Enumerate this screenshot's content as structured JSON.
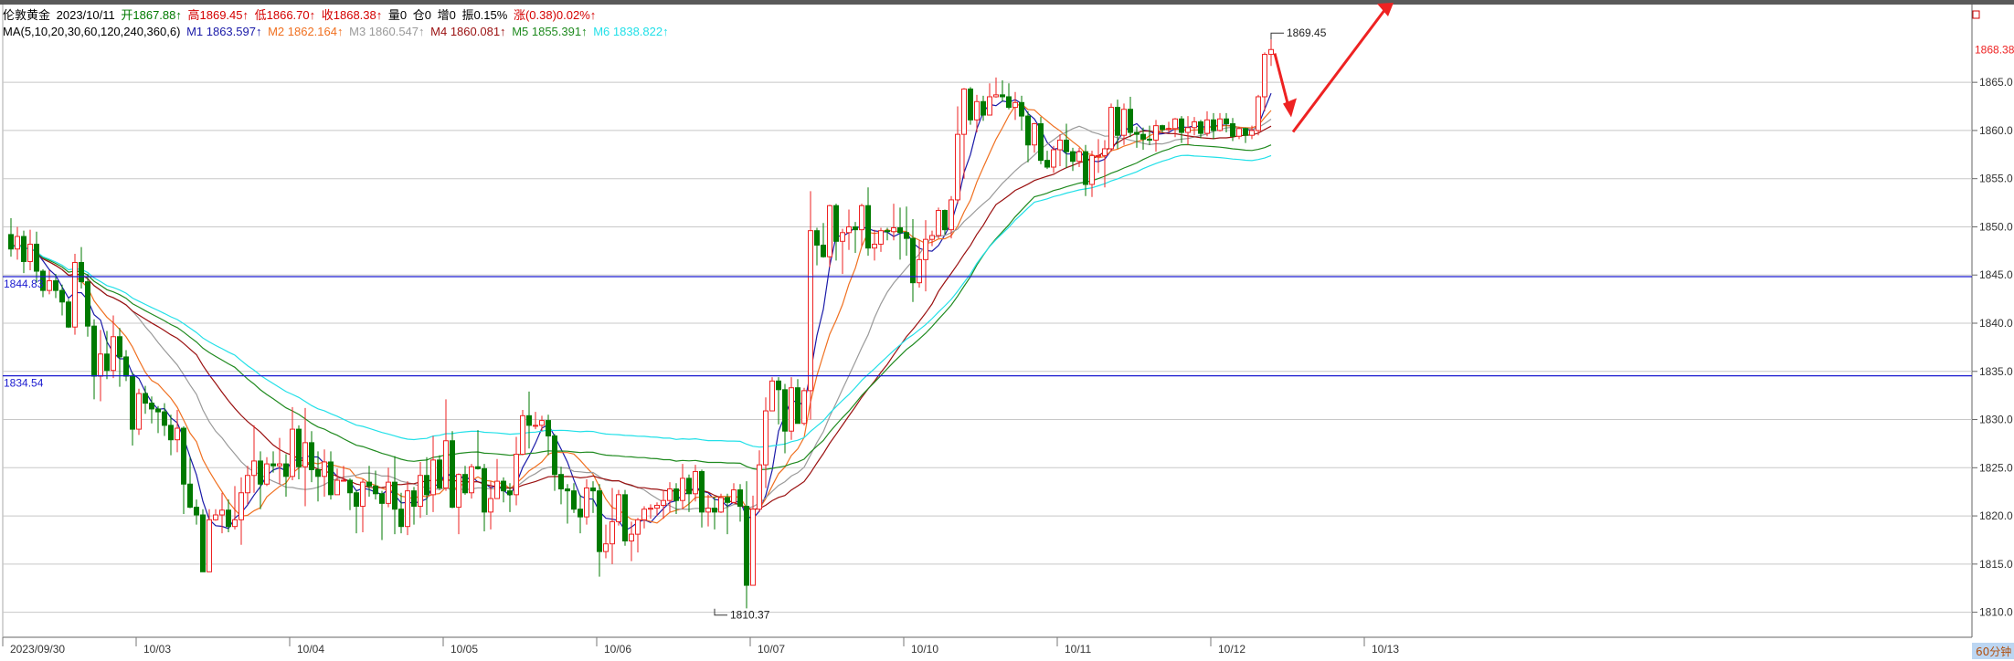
{
  "header": {
    "symbol": "伦敦黄金",
    "date": "2023/10/11",
    "open": "开1867.88↑",
    "high": "高1869.45↑",
    "low": "低1866.70↑",
    "close": "收1868.38↑",
    "volume": "量0",
    "position": "仓0",
    "increase": "增0",
    "amplitude": "振0.15%",
    "change": "涨(0.38)0.02%↑"
  },
  "ma_legend": {
    "label": "MA(5,10,20,30,60,120,240,360,6)",
    "items": [
      {
        "text": "M1 1863.597↑",
        "color": "#1a1aa8"
      },
      {
        "text": "M2 1862.164↑",
        "color": "#f07020"
      },
      {
        "text": "M3 1860.547↑",
        "color": "#9a9a9a"
      },
      {
        "text": "M4 1860.081↑",
        "color": "#9a1010"
      },
      {
        "text": "M5 1855.391↑",
        "color": "#1f8a1f"
      },
      {
        "text": "M6 1838.822↑",
        "color": "#22e0e8"
      }
    ]
  },
  "colors": {
    "up": "#ee2222",
    "down": "#007a00",
    "grid": "#c8c8c8",
    "hline": "#1a1ad0",
    "arrow": "#ee2222",
    "price_tag": "#ee2222",
    "timeframe_bg": "#bcd6f2"
  },
  "chart_data": {
    "type": "candlestick",
    "title": "",
    "xlabel": "",
    "ylabel": "",
    "ylim": [
      1807.5,
      1872.5
    ],
    "grid": true,
    "y_ticks": [
      1810.0,
      1815.0,
      1820.0,
      1825.0,
      1830.0,
      1835.0,
      1840.0,
      1845.0,
      1850.0,
      1855.0,
      1860.0,
      1865.0
    ],
    "y_tick_labels": [
      "1810.0",
      "1815.0",
      "1820.0",
      "1825.0",
      "1830.0",
      "1835.0",
      "1840.0",
      "1845.0",
      "1850.0",
      "1855.0",
      "1860.0",
      "1865.0"
    ],
    "x_labels": [
      {
        "text": "2023/09/30",
        "bar": 0
      },
      {
        "text": "10/03",
        "bar": 20
      },
      {
        "text": "10/04",
        "bar": 44
      },
      {
        "text": "10/05",
        "bar": 68
      },
      {
        "text": "10/06",
        "bar": 92
      },
      {
        "text": "10/07",
        "bar": 116
      },
      {
        "text": "10/10",
        "bar": 140
      },
      {
        "text": "10/11",
        "bar": 164
      },
      {
        "text": "10/12",
        "bar": 188
      },
      {
        "text": "10/13",
        "bar": 212
      }
    ],
    "candles": [
      [
        1849.2,
        1847.7,
        1850.9,
        1846.9
      ],
      [
        1847.7,
        1849.0,
        1850.0,
        1846.6
      ],
      [
        1849.0,
        1846.4,
        1849.6,
        1845.2
      ],
      [
        1846.4,
        1848.2,
        1849.7,
        1845.5
      ],
      [
        1848.2,
        1845.4,
        1849.5,
        1844.2
      ],
      [
        1845.4,
        1843.4,
        1845.6,
        1842.7
      ],
      [
        1843.4,
        1844.4,
        1845.5,
        1843.0
      ],
      [
        1844.4,
        1843.4,
        1845.1,
        1842.6
      ],
      [
        1843.4,
        1842.2,
        1844.0,
        1840.8
      ],
      [
        1842.2,
        1839.6,
        1842.5,
        1839.5
      ],
      [
        1839.6,
        1846.3,
        1847.2,
        1838.8
      ],
      [
        1846.3,
        1844.3,
        1847.9,
        1843.6
      ],
      [
        1844.3,
        1839.7,
        1845.1,
        1838.6
      ],
      [
        1839.7,
        1834.5,
        1840.4,
        1832.1
      ],
      [
        1834.5,
        1836.8,
        1839.3,
        1831.9
      ],
      [
        1836.8,
        1835.1,
        1839.2,
        1834.2
      ],
      [
        1835.1,
        1838.6,
        1840.8,
        1834.3
      ],
      [
        1838.6,
        1836.5,
        1839.5,
        1833.4
      ],
      [
        1836.5,
        1834.5,
        1837.2,
        1834.0
      ],
      [
        1834.5,
        1829.0,
        1834.9,
        1827.3
      ],
      [
        1829.0,
        1832.7,
        1833.2,
        1828.4
      ],
      [
        1832.7,
        1831.7,
        1833.5,
        1830.6
      ],
      [
        1831.7,
        1831.1,
        1832.4,
        1829.6
      ],
      [
        1831.1,
        1830.8,
        1831.4,
        1828.6
      ],
      [
        1830.8,
        1829.4,
        1831.7,
        1828.3
      ],
      [
        1829.4,
        1827.9,
        1830.5,
        1826.3
      ],
      [
        1827.9,
        1829.1,
        1831.0,
        1826.6
      ],
      [
        1829.1,
        1823.3,
        1829.3,
        1820.2
      ],
      [
        1823.3,
        1820.9,
        1826.1,
        1820.8
      ],
      [
        1820.9,
        1820.1,
        1821.7,
        1819.1
      ],
      [
        1820.1,
        1814.2,
        1820.7,
        1814.2
      ],
      [
        1814.2,
        1819.6,
        1820.7,
        1814.5
      ],
      [
        1819.6,
        1820.1,
        1820.7,
        1819.5
      ],
      [
        1820.1,
        1820.6,
        1822.4,
        1818.2
      ],
      [
        1820.6,
        1818.9,
        1821.7,
        1818.3
      ],
      [
        1818.9,
        1819.6,
        1823.1,
        1818.6
      ],
      [
        1819.6,
        1822.4,
        1824.0,
        1817.0
      ],
      [
        1822.4,
        1824.2,
        1825.2,
        1821.2
      ],
      [
        1824.2,
        1825.7,
        1829.4,
        1822.4
      ],
      [
        1825.7,
        1823.3,
        1826.7,
        1820.7
      ],
      [
        1823.3,
        1825.4,
        1826.1,
        1823.1
      ],
      [
        1825.4,
        1825.2,
        1826.7,
        1824.5
      ],
      [
        1825.2,
        1825.4,
        1828.1,
        1823.3
      ],
      [
        1825.4,
        1824.1,
        1826.4,
        1822.0
      ],
      [
        1824.1,
        1829.0,
        1831.3,
        1823.7
      ],
      [
        1829.0,
        1825.1,
        1829.4,
        1823.8
      ],
      [
        1825.1,
        1827.6,
        1831.2,
        1821.0
      ],
      [
        1827.6,
        1824.8,
        1828.8,
        1823.5
      ],
      [
        1824.8,
        1824.1,
        1826.7,
        1821.5
      ],
      [
        1824.1,
        1825.6,
        1826.9,
        1822.0
      ],
      [
        1825.6,
        1822.2,
        1826.7,
        1821.7
      ],
      [
        1822.2,
        1823.7,
        1824.9,
        1822.2
      ],
      [
        1823.7,
        1823.7,
        1825.2,
        1823.6
      ],
      [
        1823.7,
        1822.4,
        1823.9,
        1820.6
      ],
      [
        1822.4,
        1821.0,
        1822.7,
        1818.2
      ],
      [
        1821.0,
        1823.5,
        1823.8,
        1818.3
      ],
      [
        1823.5,
        1823.1,
        1825.2,
        1822.0
      ],
      [
        1823.1,
        1822.3,
        1824.7,
        1821.7
      ],
      [
        1822.3,
        1821.3,
        1822.6,
        1817.5
      ],
      [
        1821.3,
        1823.5,
        1825.0,
        1820.9
      ],
      [
        1823.5,
        1820.7,
        1826.2,
        1818.1
      ],
      [
        1820.7,
        1818.9,
        1822.4,
        1818.2
      ],
      [
        1818.9,
        1822.6,
        1823.6,
        1818.0
      ],
      [
        1822.6,
        1821.0,
        1823.0,
        1819.1
      ],
      [
        1821.0,
        1824.2,
        1825.6,
        1819.8
      ],
      [
        1824.2,
        1822.2,
        1826.1,
        1820.1
      ],
      [
        1822.2,
        1825.8,
        1828.3,
        1820.4
      ],
      [
        1825.8,
        1822.9,
        1826.3,
        1822.7
      ],
      [
        1822.9,
        1827.8,
        1832.1,
        1822.6
      ],
      [
        1827.8,
        1820.9,
        1828.8,
        1820.8
      ],
      [
        1820.9,
        1824.3,
        1824.4,
        1818.1
      ],
      [
        1824.3,
        1822.4,
        1825.2,
        1822.2
      ],
      [
        1822.4,
        1825.1,
        1825.4,
        1821.8
      ],
      [
        1825.1,
        1824.9,
        1828.9,
        1824.8
      ],
      [
        1824.9,
        1820.4,
        1825.4,
        1818.4
      ],
      [
        1820.4,
        1821.8,
        1823.6,
        1818.6
      ],
      [
        1821.8,
        1823.6,
        1825.9,
        1822.2
      ],
      [
        1823.6,
        1822.6,
        1824.0,
        1821.4
      ],
      [
        1822.6,
        1822.2,
        1823.4,
        1820.4
      ],
      [
        1822.2,
        1826.4,
        1828.2,
        1821.1
      ],
      [
        1826.4,
        1830.4,
        1831.0,
        1826.3
      ],
      [
        1830.4,
        1829.4,
        1832.9,
        1827.0
      ],
      [
        1829.4,
        1829.4,
        1830.8,
        1829.0
      ],
      [
        1829.4,
        1829.9,
        1830.4,
        1828.8
      ],
      [
        1829.9,
        1828.3,
        1830.5,
        1826.3
      ],
      [
        1828.3,
        1824.3,
        1828.5,
        1822.6
      ],
      [
        1824.3,
        1822.8,
        1825.1,
        1821.2
      ],
      [
        1822.8,
        1822.6,
        1823.3,
        1819.2
      ],
      [
        1822.6,
        1820.7,
        1823.4,
        1820.3
      ],
      [
        1820.7,
        1819.9,
        1822.2,
        1818.2
      ],
      [
        1819.9,
        1822.9,
        1823.8,
        1819.1
      ],
      [
        1822.9,
        1822.6,
        1823.6,
        1820.3
      ],
      [
        1822.6,
        1816.3,
        1823.3,
        1813.7
      ],
      [
        1816.3,
        1817.1,
        1819.1,
        1815.6
      ],
      [
        1817.1,
        1819.4,
        1822.9,
        1815.0
      ],
      [
        1819.4,
        1822.2,
        1822.7,
        1819.0
      ],
      [
        1822.2,
        1817.4,
        1822.7,
        1816.9
      ],
      [
        1817.4,
        1818.1,
        1819.4,
        1815.3
      ],
      [
        1818.1,
        1819.6,
        1819.8,
        1816.2
      ],
      [
        1819.6,
        1820.7,
        1821.0,
        1818.7
      ],
      [
        1820.7,
        1820.8,
        1821.2,
        1819.7
      ],
      [
        1820.8,
        1821.1,
        1821.4,
        1820.0
      ],
      [
        1821.1,
        1821.6,
        1822.7,
        1819.7
      ],
      [
        1821.6,
        1822.8,
        1823.5,
        1820.4
      ],
      [
        1822.8,
        1821.6,
        1823.4,
        1820.2
      ],
      [
        1821.6,
        1823.9,
        1825.4,
        1820.7
      ],
      [
        1823.9,
        1822.3,
        1824.3,
        1820.4
      ],
      [
        1822.3,
        1824.6,
        1825.3,
        1821.5
      ],
      [
        1824.6,
        1820.4,
        1824.8,
        1818.8
      ],
      [
        1820.4,
        1820.8,
        1822.2,
        1818.9
      ],
      [
        1820.8,
        1820.4,
        1822.0,
        1818.6
      ],
      [
        1820.4,
        1821.9,
        1822.3,
        1820.3
      ],
      [
        1821.9,
        1821.4,
        1822.3,
        1818.1
      ],
      [
        1821.4,
        1822.7,
        1823.4,
        1821.3
      ],
      [
        1822.7,
        1821.0,
        1823.3,
        1819.4
      ],
      [
        1821.0,
        1812.8,
        1823.6,
        1810.4
      ],
      [
        1812.8,
        1820.7,
        1822.1,
        1813.9
      ],
      [
        1820.7,
        1825.3,
        1826.8,
        1820.4
      ],
      [
        1825.3,
        1830.9,
        1832.3,
        1822.9
      ],
      [
        1830.9,
        1834.0,
        1834.4,
        1830.9
      ],
      [
        1834.0,
        1833.1,
        1834.4,
        1829.5
      ],
      [
        1833.1,
        1828.8,
        1833.7,
        1826.5
      ],
      [
        1828.8,
        1833.3,
        1834.4,
        1827.9
      ],
      [
        1833.3,
        1829.6,
        1834.2,
        1829.6
      ],
      [
        1829.6,
        1833.0,
        1833.3,
        1829.4
      ],
      [
        1833.0,
        1849.6,
        1853.7,
        1830.0
      ],
      [
        1849.6,
        1848.1,
        1849.9,
        1846.0
      ],
      [
        1848.1,
        1846.9,
        1850.4,
        1846.8
      ],
      [
        1846.9,
        1852.2,
        1852.3,
        1845.8
      ],
      [
        1852.2,
        1848.5,
        1852.4,
        1846.5
      ],
      [
        1848.5,
        1849.4,
        1849.8,
        1845.1
      ],
      [
        1849.4,
        1850.0,
        1851.8,
        1847.6
      ],
      [
        1850.0,
        1849.7,
        1850.5,
        1847.3
      ],
      [
        1849.7,
        1852.2,
        1852.4,
        1848.0
      ],
      [
        1852.2,
        1847.8,
        1854.1,
        1847.0
      ],
      [
        1847.8,
        1848.2,
        1849.7,
        1846.5
      ],
      [
        1848.2,
        1849.6,
        1849.9,
        1847.4
      ],
      [
        1849.6,
        1849.5,
        1849.9,
        1848.6
      ],
      [
        1849.5,
        1849.9,
        1852.4,
        1848.6
      ],
      [
        1849.9,
        1849.4,
        1852.0,
        1846.6
      ],
      [
        1849.4,
        1848.8,
        1852.1,
        1847.0
      ],
      [
        1848.8,
        1844.2,
        1850.8,
        1842.2
      ],
      [
        1844.2,
        1846.6,
        1848.6,
        1843.7
      ],
      [
        1846.6,
        1848.7,
        1850.7,
        1843.3
      ],
      [
        1848.7,
        1849.1,
        1849.6,
        1848.0
      ],
      [
        1849.1,
        1851.7,
        1852.0,
        1848.8
      ],
      [
        1851.7,
        1849.7,
        1851.8,
        1849.2
      ],
      [
        1849.7,
        1852.8,
        1853.2,
        1848.8
      ],
      [
        1852.8,
        1859.6,
        1862.5,
        1852.4
      ],
      [
        1859.6,
        1864.3,
        1864.4,
        1855.0
      ],
      [
        1864.3,
        1861.1,
        1864.5,
        1860.6
      ],
      [
        1861.1,
        1863.0,
        1863.7,
        1859.8
      ],
      [
        1863.0,
        1861.6,
        1863.6,
        1861.0
      ],
      [
        1861.6,
        1863.5,
        1864.9,
        1861.6
      ],
      [
        1863.5,
        1863.7,
        1865.5,
        1863.4
      ],
      [
        1863.7,
        1863.5,
        1865.2,
        1863.0
      ],
      [
        1863.5,
        1862.4,
        1864.9,
        1862.2
      ],
      [
        1862.4,
        1862.9,
        1864.0,
        1861.1
      ],
      [
        1862.9,
        1861.5,
        1863.6,
        1860.0
      ],
      [
        1861.5,
        1858.5,
        1862.0,
        1856.7
      ],
      [
        1858.5,
        1860.7,
        1860.8,
        1857.7
      ],
      [
        1860.7,
        1856.9,
        1861.4,
        1856.5
      ],
      [
        1856.9,
        1856.2,
        1857.9,
        1856.0
      ],
      [
        1856.2,
        1858.0,
        1858.4,
        1855.6
      ],
      [
        1858.0,
        1859.0,
        1859.6,
        1856.3
      ],
      [
        1859.0,
        1857.8,
        1860.7,
        1856.1
      ],
      [
        1857.8,
        1856.8,
        1858.2,
        1855.8
      ],
      [
        1856.8,
        1857.8,
        1858.2,
        1856.2
      ],
      [
        1857.8,
        1854.4,
        1858.5,
        1853.2
      ],
      [
        1854.4,
        1857.4,
        1857.9,
        1853.1
      ],
      [
        1857.4,
        1857.4,
        1859.1,
        1855.6
      ],
      [
        1857.4,
        1858.1,
        1859.0,
        1854.1
      ],
      [
        1858.1,
        1862.4,
        1862.8,
        1857.8
      ],
      [
        1862.4,
        1859.5,
        1863.2,
        1858.1
      ],
      [
        1859.5,
        1862.2,
        1862.8,
        1858.5
      ],
      [
        1862.2,
        1859.8,
        1863.5,
        1859.3
      ],
      [
        1859.8,
        1859.6,
        1860.4,
        1858.2
      ],
      [
        1859.6,
        1859.1,
        1860.3,
        1858.0
      ],
      [
        1859.1,
        1859.0,
        1860.5,
        1858.5
      ],
      [
        1859.0,
        1860.5,
        1861.1,
        1857.8
      ],
      [
        1860.5,
        1860.1,
        1860.6,
        1859.8
      ],
      [
        1860.1,
        1860.2,
        1860.9,
        1859.8
      ],
      [
        1860.2,
        1861.2,
        1861.3,
        1859.3
      ],
      [
        1861.2,
        1859.8,
        1861.5,
        1858.7
      ],
      [
        1859.8,
        1860.3,
        1861.5,
        1858.5
      ],
      [
        1860.3,
        1860.9,
        1861.4,
        1859.5
      ],
      [
        1860.9,
        1859.7,
        1861.1,
        1859.2
      ],
      [
        1859.7,
        1861.1,
        1862.0,
        1859.4
      ],
      [
        1861.1,
        1860.0,
        1861.8,
        1859.1
      ],
      [
        1860.0,
        1861.2,
        1861.8,
        1859.9
      ],
      [
        1861.2,
        1860.7,
        1861.8,
        1859.8
      ],
      [
        1860.7,
        1859.4,
        1861.3,
        1858.9
      ],
      [
        1859.4,
        1860.2,
        1860.4,
        1859.1
      ],
      [
        1860.2,
        1859.5,
        1860.3,
        1858.7
      ],
      [
        1859.5,
        1860.0,
        1860.5,
        1859.1
      ],
      [
        1860.0,
        1863.5,
        1863.7,
        1859.5
      ],
      [
        1863.5,
        1867.9,
        1868.1,
        1862.0
      ],
      [
        1867.9,
        1868.4,
        1869.45,
        1866.7
      ]
    ],
    "moving_averages": [
      {
        "name": "M1",
        "period": 5,
        "color": "#1a1aa8"
      },
      {
        "name": "M2",
        "period": 10,
        "color": "#f07020"
      },
      {
        "name": "M3",
        "period": 20,
        "color": "#9a9a9a"
      },
      {
        "name": "M4",
        "period": 30,
        "color": "#9a1010"
      },
      {
        "name": "M5",
        "period": 60,
        "color": "#1f8a1f"
      },
      {
        "name": "M6",
        "period": 120,
        "color": "#22e0e8"
      }
    ],
    "horizontal_lines": [
      {
        "value": 1844.83,
        "label": "1844.83"
      },
      {
        "value": 1834.54,
        "label": "1834.54"
      }
    ],
    "annotations": [
      {
        "text": "1869.45",
        "bar": 197,
        "price": 1869.45,
        "kind": "high"
      },
      {
        "text": "1810.37",
        "bar": 110,
        "price": 1810.37,
        "kind": "low"
      }
    ],
    "last_price": {
      "value": 1868.38,
      "label": "1868.38"
    },
    "timeframe": "60分钟"
  }
}
